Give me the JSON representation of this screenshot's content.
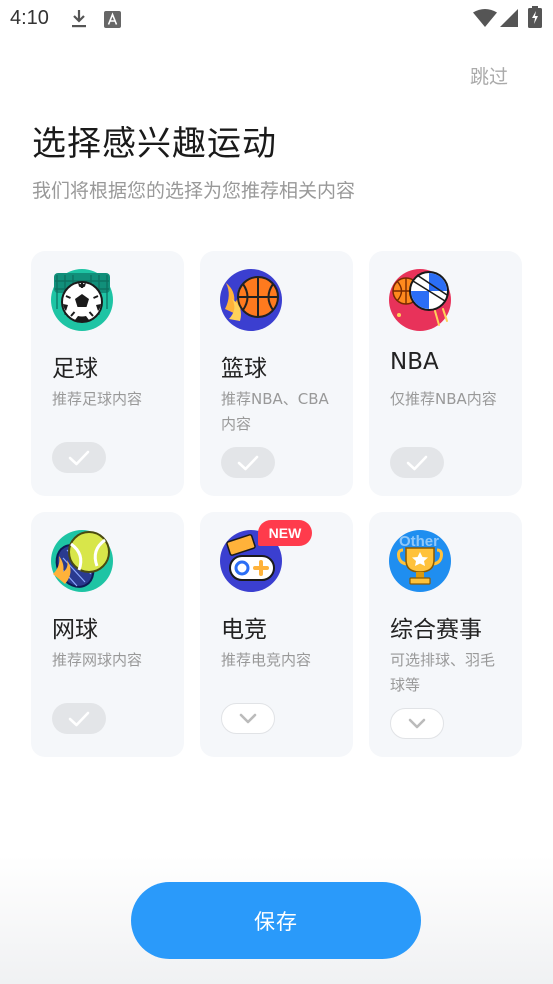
{
  "status_bar": {
    "time": "4:10",
    "icons": [
      "download-icon",
      "text-a-icon",
      "wifi-icon",
      "signal-icon",
      "battery-icon"
    ]
  },
  "header": {
    "skip_label": "跳过",
    "title": "选择感兴趣运动",
    "subtitle": "我们将根据您的选择为您推荐相关内容"
  },
  "cards": [
    {
      "name": "足球",
      "desc": "推荐足球内容",
      "icon": "soccer-ball-icon",
      "state": "checked"
    },
    {
      "name": "篮球",
      "desc": "推荐NBA、CBA内容",
      "icon": "basketball-icon",
      "state": "checked"
    },
    {
      "name": "NBA",
      "desc": "仅推荐NBA内容",
      "icon": "nba-ball-icon",
      "state": "checked"
    },
    {
      "name": "网球",
      "desc": "推荐网球内容",
      "icon": "tennis-ball-icon",
      "state": "checked"
    },
    {
      "name": "电竞",
      "desc": "推荐电竞内容",
      "icon": "gamepad-icon",
      "state": "expand",
      "badge": "NEW"
    },
    {
      "name": "综合赛事",
      "desc": "可选排球、羽毛球等",
      "icon": "trophy-icon",
      "state": "expand",
      "icon_text": "Other"
    }
  ],
  "colors": {
    "accent": "#2a9afa",
    "card_bg": "#f5f7fa",
    "badge": "#ff3b4c",
    "muted_text": "#999999"
  },
  "footer": {
    "save_label": "保存"
  }
}
